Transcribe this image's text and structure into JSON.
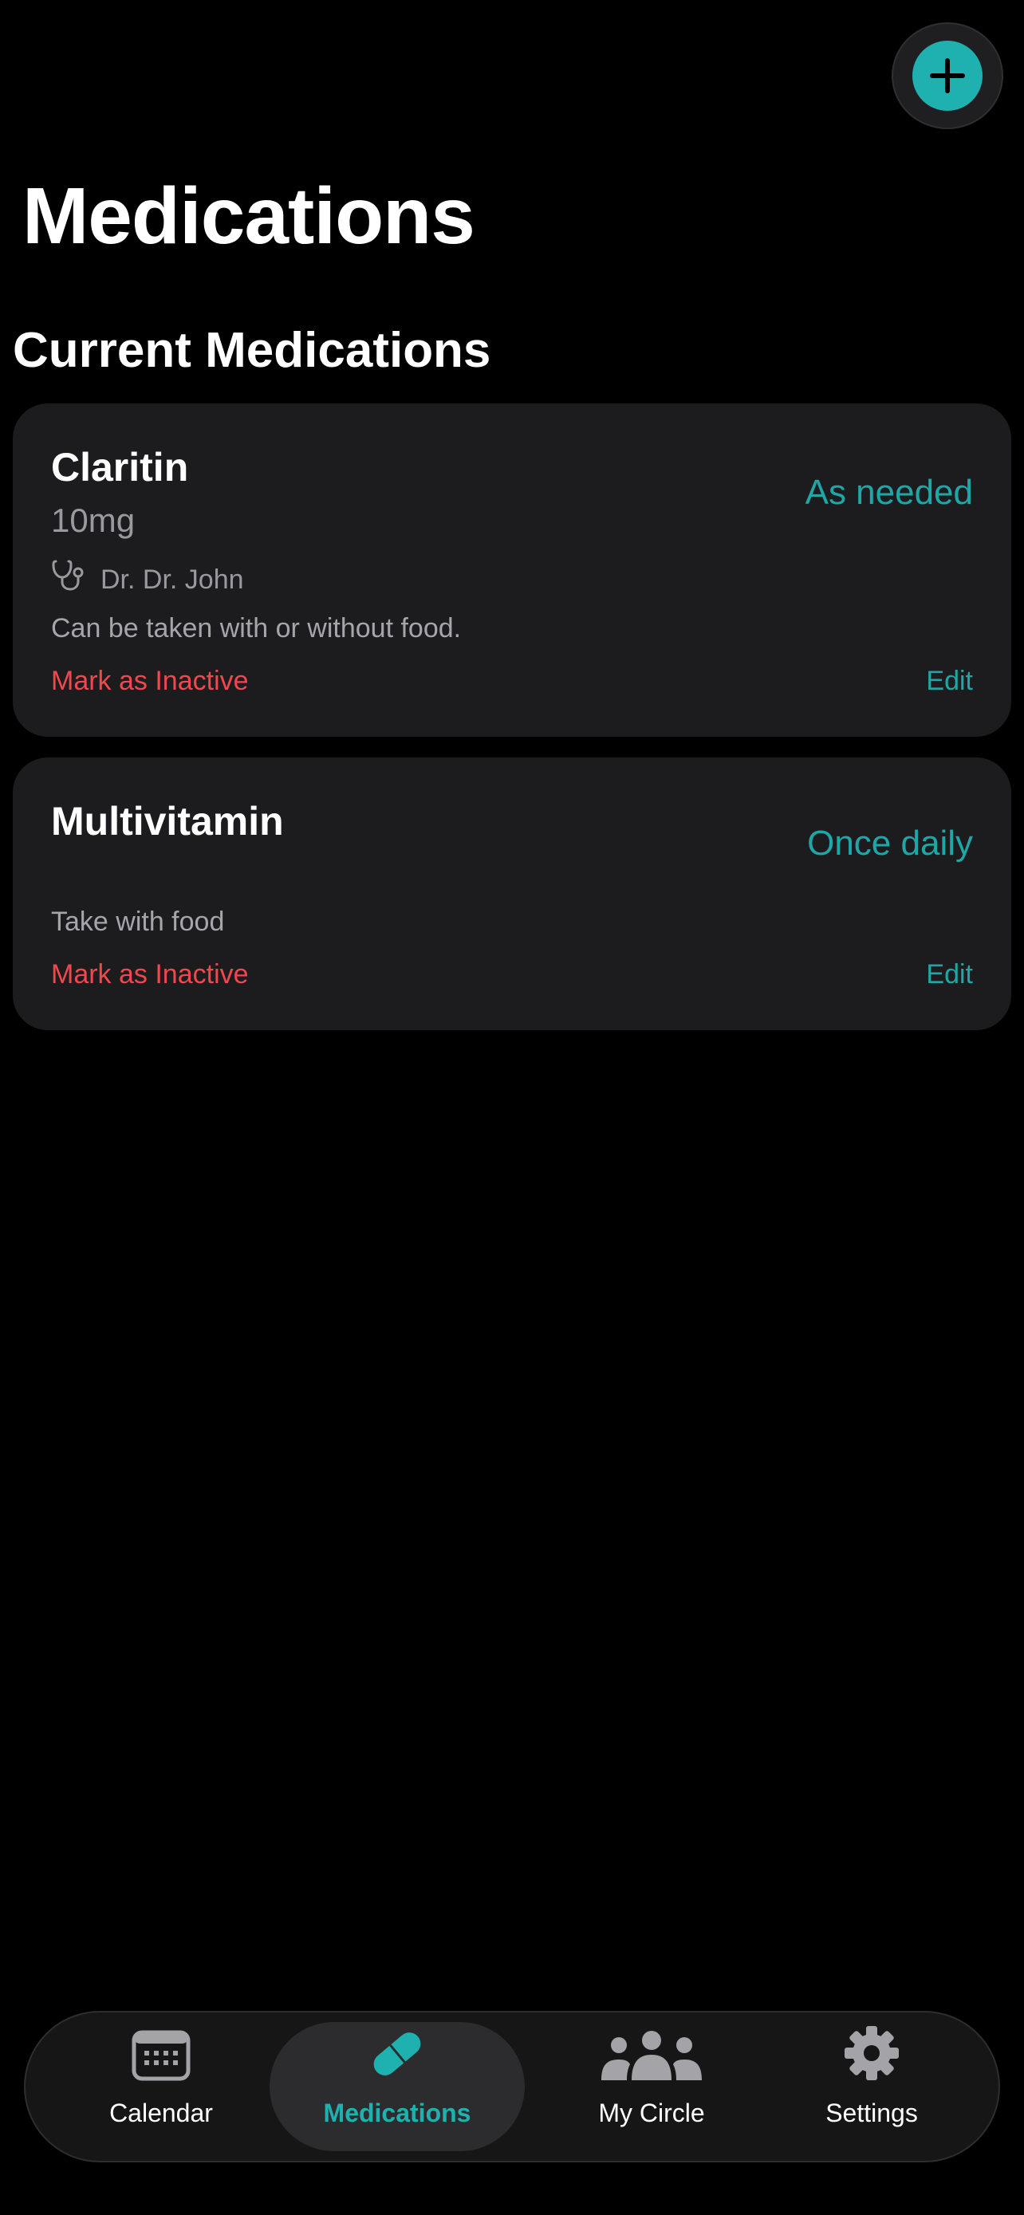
{
  "header": {
    "title": "Medications",
    "add_icon": "plus-icon"
  },
  "section": {
    "title": "Current Medications"
  },
  "medications": [
    {
      "name": "Claritin",
      "frequency": "As needed",
      "dosage": "10mg",
      "doctor": "Dr. Dr. John",
      "doctor_icon": "stethoscope-icon",
      "notes": "Can be taken with or without food.",
      "inactive_label": "Mark as Inactive",
      "edit_label": "Edit"
    },
    {
      "name": "Multivitamin",
      "frequency": "Once daily",
      "notes": "Take with food",
      "inactive_label": "Mark as Inactive",
      "edit_label": "Edit"
    }
  ],
  "tabs": [
    {
      "label": "Calendar",
      "icon": "calendar-icon",
      "active": false
    },
    {
      "label": "Medications",
      "icon": "pill-icon",
      "active": true
    },
    {
      "label": "My Circle",
      "icon": "people-icon",
      "active": false
    },
    {
      "label": "Settings",
      "icon": "gear-icon",
      "active": false
    }
  ],
  "colors": {
    "accent": "#1fb1b0",
    "danger": "#f0484d",
    "card": "#1c1c1e",
    "background": "#000000"
  }
}
